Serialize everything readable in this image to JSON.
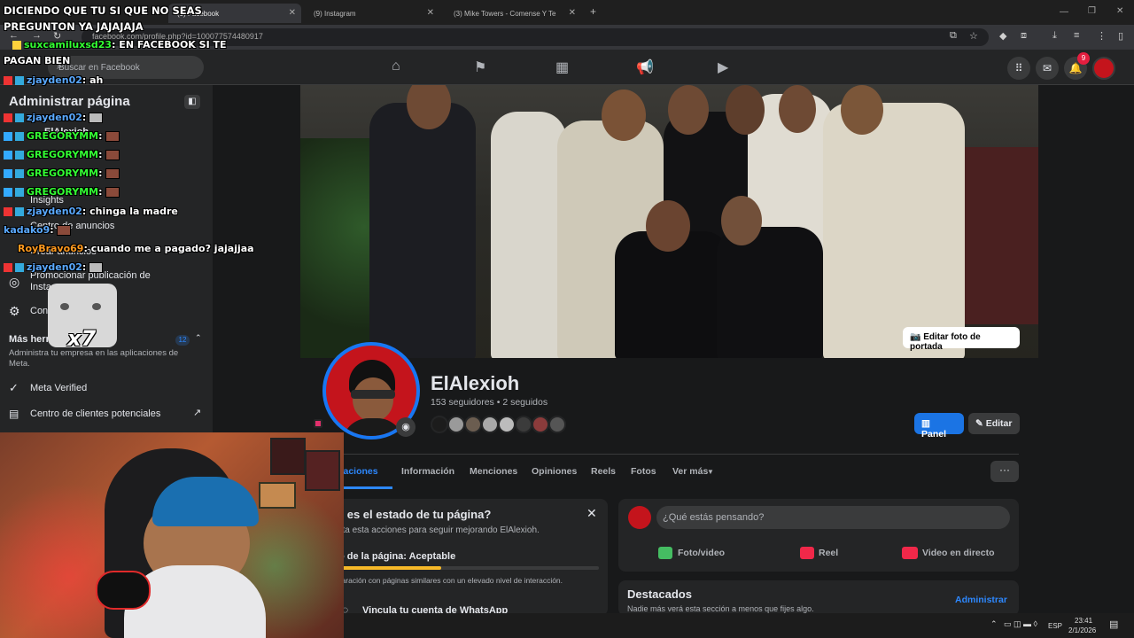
{
  "browser": {
    "tabs": [
      {
        "label": "(9) Facebook",
        "color": "#1877f2"
      },
      {
        "label": "(9) Instagram",
        "color": "#e1306c"
      },
      {
        "label": "(3) Mike Towers - Comense Y Te",
        "color": "#ff0000"
      }
    ],
    "new_tab": "+",
    "url": "facebook.com/profile.php?id=100077574480917"
  },
  "fb": {
    "search_placeholder": "Buscar en Facebook",
    "notif_count": "9"
  },
  "sidebar": {
    "title": "Administrar página",
    "page_name": "ElAlexioh",
    "items": [
      {
        "label": "Insights"
      },
      {
        "label": "Centro de anuncios"
      },
      {
        "label": "Crear anuncios"
      },
      {
        "label": "Promocionar publicación de Instagram"
      },
      {
        "label": "Configuración"
      }
    ],
    "more_tools": "Más herramientas",
    "more_tools_count": "12",
    "more_tools_desc": "Administra tu empresa en las aplicaciones de Meta.",
    "meta_verified": "Meta Verified",
    "leads_center": "Centro de clientes potenciales"
  },
  "overlay": {
    "title_line1": "DICIENDO QUE TU SI QUE NO SEAS",
    "title_line2": "PREGUNTON YA JAJAJAJA",
    "chat": [
      {
        "user": "suxcamiluxsd23",
        "msg": ": EN FACEBOOK SI TE",
        "user_color": "#33ff33"
      },
      {
        "user": "",
        "msg": "PAGAN BIEN",
        "user_color": "#ffffff"
      },
      {
        "user": "zjayden02",
        "msg": ": ah",
        "user_color": "#5aa9ff"
      },
      {
        "user": "zjayden02",
        "msg": ":",
        "user_color": "#5aa9ff"
      },
      {
        "user": "GREGORYMM",
        "msg": ":",
        "user_color": "#33ff33"
      },
      {
        "user": "GREGORYMM",
        "msg": ":",
        "user_color": "#33ff33"
      },
      {
        "user": "GREGORYMM",
        "msg": ":",
        "user_color": "#33ff33"
      },
      {
        "user": "GREGORYMM",
        "msg": ":",
        "user_color": "#33ff33"
      },
      {
        "user": "zjayden02",
        "msg": ": chinga la madre",
        "user_color": "#5aa9ff"
      },
      {
        "user": "kadako9",
        "msg": ":",
        "user_color": "#5aa9ff"
      },
      {
        "user": "RoyBravo69",
        "msg": ": cuando me a pagado? jajajjaa",
        "user_color": "#ff9a1f"
      },
      {
        "user": "zjayden02",
        "msg": ":",
        "user_color": "#5aa9ff"
      }
    ],
    "multiplier": "x7"
  },
  "profile": {
    "edit_cover": "Editar foto de portada",
    "name": "ElAlexioh",
    "followers": "153 seguidores • 2 seguidos",
    "panel_btn": "Panel",
    "edit_btn": "Editar",
    "tabs": [
      "Publicaciones",
      "Información",
      "Menciones",
      "Opiniones",
      "Reels",
      "Fotos",
      "Ver más"
    ],
    "more": "···"
  },
  "status_card": {
    "title": "¿Cuál es el estado de tu página?",
    "desc": "Completa esta acciones para seguir mejorando ElAlexioh.",
    "status_label": "Estado de la página: Aceptable",
    "progress": 0.45,
    "compare": "En comparación con páginas similares con un elevado nivel de interacción.",
    "whatsapp": "Vincula tu cuenta de WhatsApp"
  },
  "composer": {
    "placeholder": "¿Qué estás pensando?",
    "photo": "Foto/video",
    "reel": "Reel",
    "live": "Video en directo"
  },
  "highlights": {
    "title": "Destacados",
    "desc": "Nadie más verá esta sección a menos que fijes algo.",
    "manage": "Administrar"
  },
  "taskbar": {
    "lang": "ESP",
    "time": "23:41",
    "date": "2/1/2026"
  }
}
